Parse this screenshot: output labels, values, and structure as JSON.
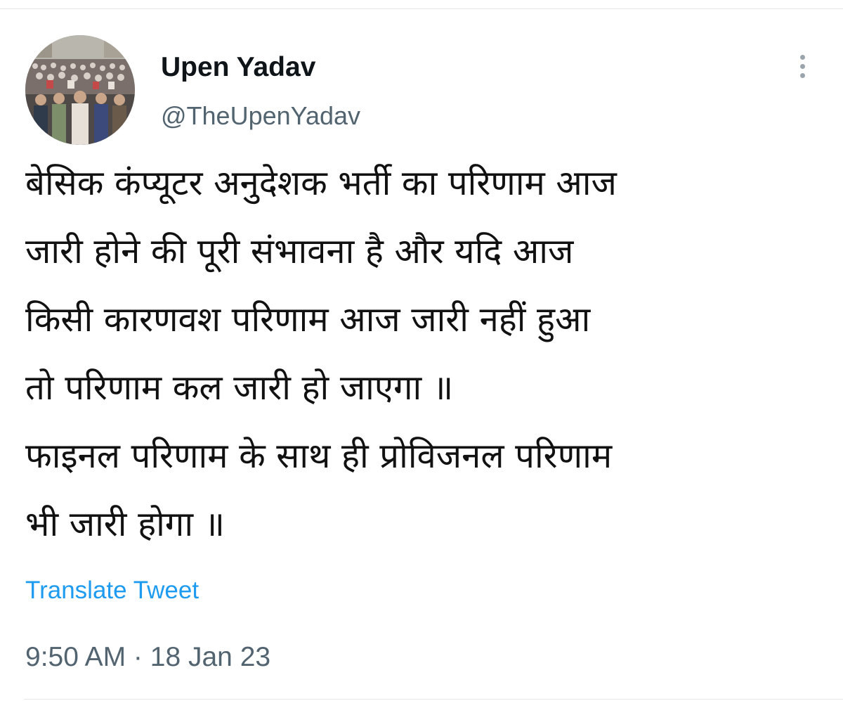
{
  "tweet": {
    "author": {
      "display_name": "Upen Yadav",
      "handle": "@TheUpenYadav",
      "avatar": "avatar-photo-crowd"
    },
    "menu_icon": "more-vertical-icon",
    "text_lines": [
      "बेसिक कंप्यूटर अनुदेशक भर्ती का परिणाम आज",
      "जारी होने की पूरी संभावना है और यदि आज",
      "किसी कारणवश परिणाम आज जारी नहीं हुआ",
      "तो परिणाम कल जारी हो जाएगा ॥",
      "फाइनल परिणाम के साथ ही प्रोविजनल परिणाम",
      "भी जारी होगा ॥"
    ],
    "translate_label": "Translate Tweet",
    "time": "9:50 AM",
    "separator": " · ",
    "date": "18 Jan 23"
  },
  "colors": {
    "link": "#1d9bf0",
    "secondary_text": "#536471",
    "primary_text": "#0f1419",
    "divider": "#e6e9ec"
  }
}
